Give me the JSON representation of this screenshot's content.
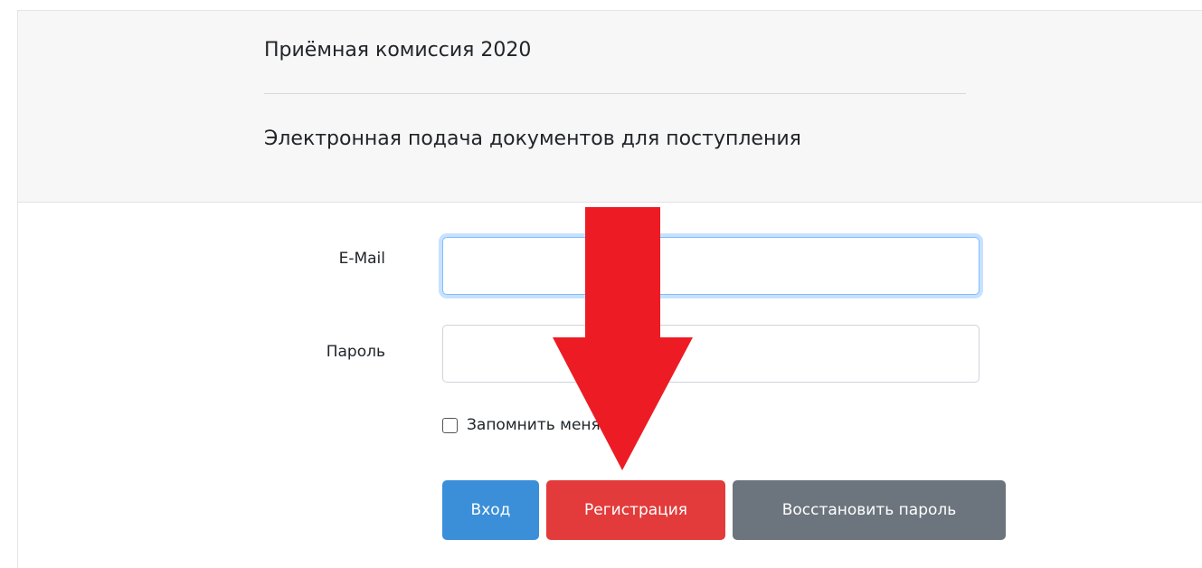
{
  "header": {
    "title": "Приёмная комиссия 2020",
    "subtitle": "Электронная подача документов для поступления"
  },
  "form": {
    "email_label": "E-Mail",
    "email_value": "",
    "password_label": "Пароль",
    "password_value": "",
    "remember_label": "Запомнить меня",
    "remember_checked": false
  },
  "buttons": {
    "login": "Вход",
    "register": "Регистрация",
    "restore": "Восстановить пароль"
  },
  "colors": {
    "login_button": "#3a8fd8",
    "register_button": "#e33b3b",
    "restore_button": "#6c757d",
    "arrow": "#ed1c24",
    "header_bg": "#f7f7f7"
  },
  "annotation": {
    "icon": "arrow-down-icon",
    "points_to": "register-button"
  }
}
